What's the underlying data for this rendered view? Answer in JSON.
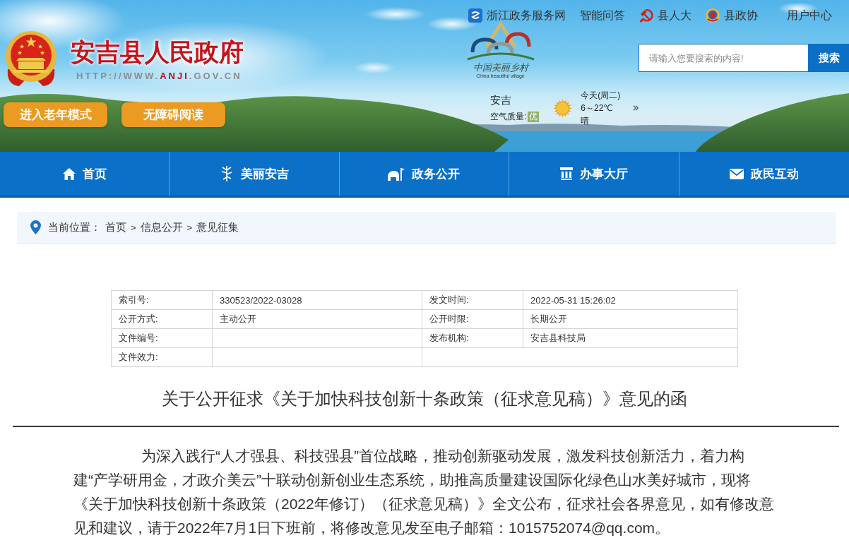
{
  "header": {
    "site_title": "安吉县人民政府",
    "url_parts": [
      {
        "text": "HTTP://WWW.",
        "highlight": false
      },
      {
        "text": "ANJI",
        "highlight": true
      },
      {
        "text": ".GOV.CN",
        "highlight": false
      }
    ],
    "mode_buttons": [
      "进入老年模式",
      "无障碍阅读"
    ],
    "top_links": [
      "浙江政务服务网",
      "智能问答",
      "县人大",
      "县政协",
      "用户中心"
    ],
    "logo": {
      "title": "中国美丽乡村",
      "subtitle": "China beautiful village"
    },
    "search": {
      "placeholder": "请输入您要搜索的内容!",
      "button": "搜索"
    },
    "weather": {
      "city": "安吉",
      "air_quality_label": "空气质量:",
      "air_quality": "优",
      "day": "今天(周二)",
      "temperature": "6～22℃",
      "condition": "晴"
    }
  },
  "nav": {
    "items": [
      "首页",
      "美丽安吉",
      "政务公开",
      "办事大厅",
      "政民互动"
    ]
  },
  "breadcrumb": {
    "label": "当前位置：",
    "items": [
      "首页",
      "信息公开",
      "意见征集"
    ],
    "separators": [
      ">",
      ">"
    ]
  },
  "info_table": {
    "rows": [
      {
        "label_1": "索引号:",
        "value_1": "330523/2022-03028",
        "label_2": "发文时间:",
        "value_2": "2022-05-31 15:26:02"
      },
      {
        "label_1": "公开方式:",
        "value_1": "主动公开",
        "label_2": "公开时限:",
        "value_2": "长期公开"
      },
      {
        "label_1": "文件编号:",
        "label_2": "发布机构:",
        "value_2": "安吉县科技局"
      },
      {
        "label_1": "文件效力:"
      }
    ]
  },
  "article": {
    "title": "关于公开征求《关于加快科技创新十条政策（征求意见稿）》意见的函",
    "paragraph": "为深入践行“人才强县、科技强县”首位战略，推动创新驱动发展，激发科技创新活力，着力构建“产学研用金，才政介美云”十联动创新创业生态系统，助推高质量建设国际化绿色山水美好城市，现将《关于加快科技创新十条政策（2022年修订）（征求意见稿）》全文公布，征求社会各界意见，如有修改意见和建议，请于2022年7月1日下班前，将修改意见发至电子邮箱：1015752074@qq.com。"
  }
}
